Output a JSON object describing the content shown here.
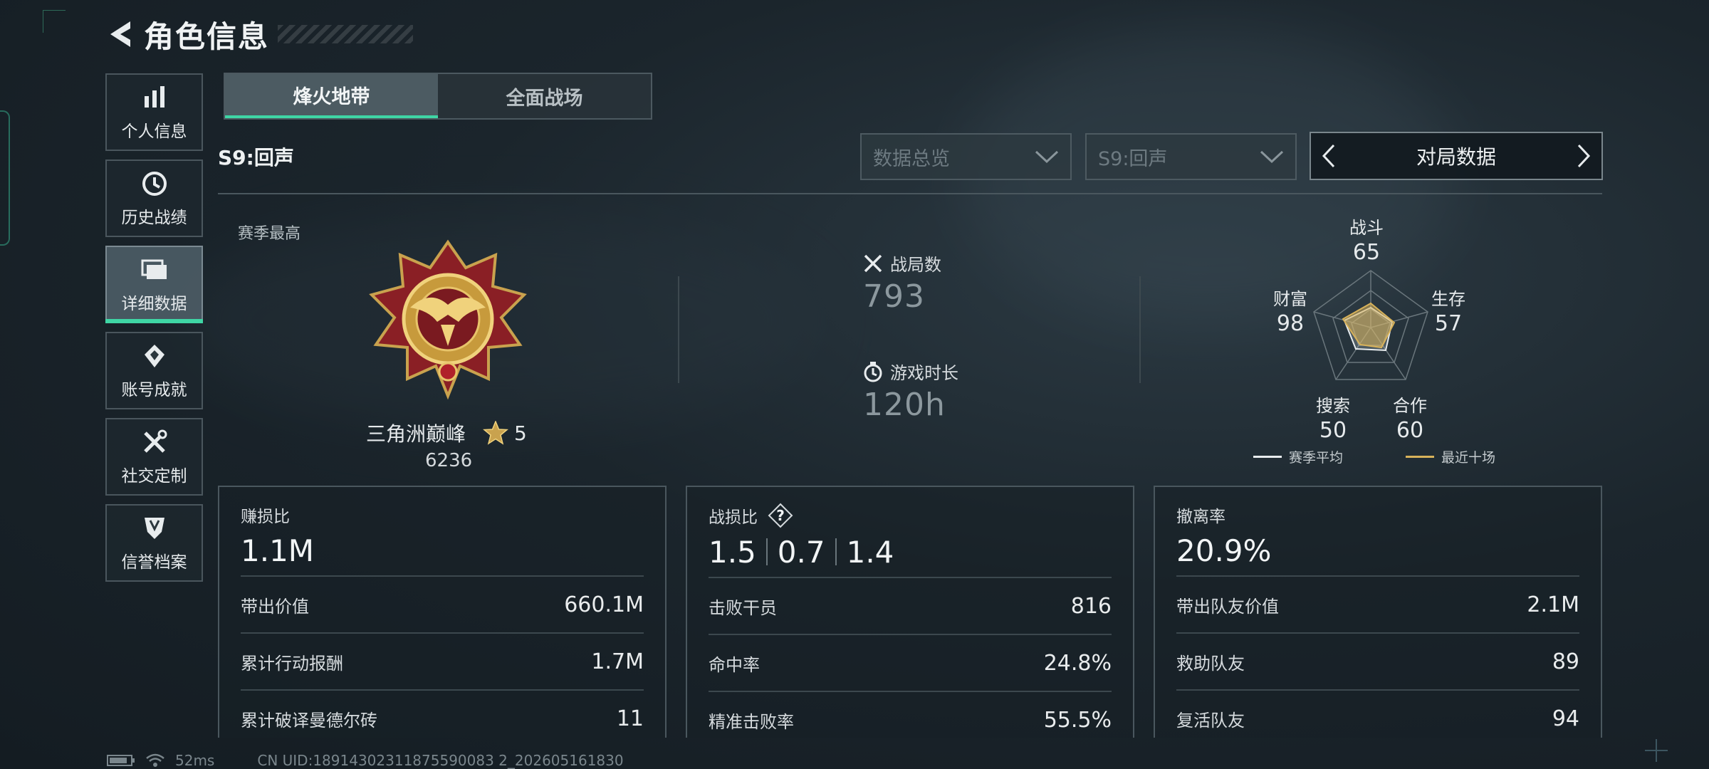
{
  "header": {
    "title": "角色信息"
  },
  "nav": {
    "items": [
      {
        "label": "个人信息",
        "icon": "bar-chart-icon"
      },
      {
        "label": "历史战绩",
        "icon": "history-clock-icon"
      },
      {
        "label": "详细数据",
        "icon": "folder-icon"
      },
      {
        "label": "账号成就",
        "icon": "achievement-icon"
      },
      {
        "label": "社交定制",
        "icon": "tools-icon"
      },
      {
        "label": "信誉档案",
        "icon": "shield-icon"
      }
    ],
    "active_index": 2
  },
  "mode_tabs": [
    {
      "label": "烽火地带"
    },
    {
      "label": "全面战场"
    }
  ],
  "season": {
    "label": "S9:回声",
    "dropdown1": "数据总览",
    "dropdown2": "S9:回声",
    "pager_label": "对局数据"
  },
  "overview": {
    "season_best_label": "赛季最高",
    "rank_name": "三角洲巅峰",
    "rank_stars": "5",
    "rank_score": "6236",
    "matches_label": "战局数",
    "matches_value": "793",
    "playtime_label": "游戏时长",
    "playtime_value": "120h"
  },
  "radar": {
    "labels": [
      {
        "name": "战斗",
        "value": "65"
      },
      {
        "name": "生存",
        "value": "57"
      },
      {
        "name": "合作",
        "value": "60"
      },
      {
        "name": "搜索",
        "value": "50"
      },
      {
        "name": "财富",
        "value": "98"
      }
    ],
    "legend_avg": "赛季平均",
    "legend_recent": "最近十场",
    "colors": {
      "avg": "#e8ecee",
      "recent": "#d8b25a"
    }
  },
  "cards": [
    {
      "title": "赚损比",
      "main": "1.1M",
      "rows": [
        {
          "label": "带出价值",
          "value": "660.1M"
        },
        {
          "label": "累计行动报酬",
          "value": "1.7M"
        },
        {
          "label": "累计破译曼德尔砖",
          "value": "11"
        }
      ]
    },
    {
      "title": "战损比",
      "help": "?",
      "main_parts": [
        "1.5",
        "0.7",
        "1.4"
      ],
      "rows": [
        {
          "label": "击败干员",
          "value": "816"
        },
        {
          "label": "命中率",
          "value": "24.8%"
        },
        {
          "label": "精准击败率",
          "value": "55.5%"
        }
      ]
    },
    {
      "title": "撤离率",
      "main": "20.9%",
      "rows": [
        {
          "label": "带出队友价值",
          "value": "2.1M"
        },
        {
          "label": "救助队友",
          "value": "89"
        },
        {
          "label": "复活队友",
          "value": "94"
        }
      ]
    }
  ],
  "status": {
    "ping": "52ms",
    "uid": "CN UID:18914302311875590083 2_202605161830"
  },
  "accent": "#3fd6a5"
}
